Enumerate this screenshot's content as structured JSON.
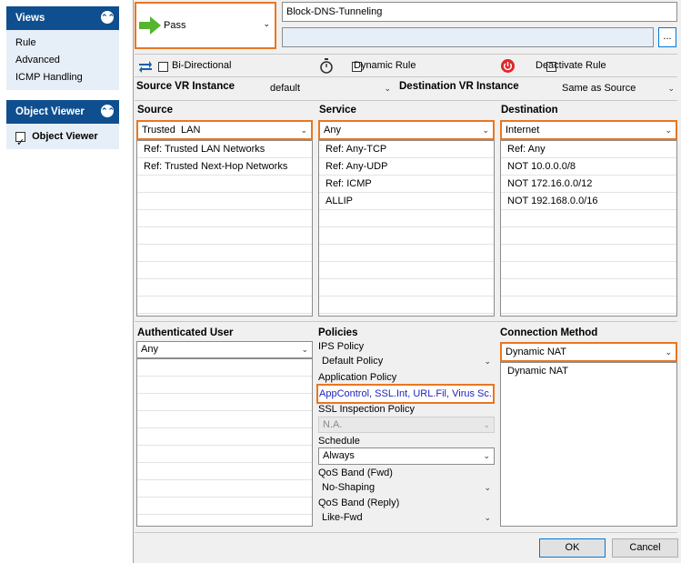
{
  "views": {
    "title": "Views",
    "items": [
      "Rule",
      "Advanced",
      "ICMP Handling"
    ]
  },
  "object_viewer": {
    "title": "Object Viewer",
    "checkbox_label": "Object Viewer",
    "checked": true
  },
  "action": {
    "label": "Pass",
    "color": "#55b52e"
  },
  "rule": {
    "name": "Block-DNS-Tunneling",
    "comment": "",
    "browse_label": "..."
  },
  "options": {
    "bidirectional": "Bi-Directional",
    "dynamic_rule": "Dynamic Rule",
    "deactivate_rule": "Deactivate Rule"
  },
  "vr": {
    "source_label": "Source VR Instance",
    "source_value": "default",
    "dest_label": "Destination VR Instance",
    "dest_value": "Same as Source"
  },
  "source": {
    "label": "Source",
    "selected": "Trusted  LAN",
    "items": [
      "Ref: Trusted LAN Networks",
      "Ref: Trusted Next-Hop Networks"
    ]
  },
  "service": {
    "label": "Service",
    "selected": "Any",
    "items": [
      "Ref: Any-TCP",
      "Ref: Any-UDP",
      "Ref: ICMP",
      "ALLIP"
    ]
  },
  "destination": {
    "label": "Destination",
    "selected": "Internet",
    "items": [
      "Ref: Any",
      "NOT 10.0.0.0/8",
      "NOT 172.16.0.0/12",
      "NOT 192.168.0.0/16"
    ]
  },
  "auth_user": {
    "label": "Authenticated User",
    "selected": "Any"
  },
  "policies": {
    "label": "Policies",
    "ips_label": "IPS Policy",
    "ips_value": "Default Policy",
    "app_label": "Application Policy",
    "app_value": "AppControl, SSL.Int, URL.Fil, Virus Sc...",
    "ssl_label": "SSL Inspection Policy",
    "ssl_value": "N.A.",
    "schedule_label": "Schedule",
    "schedule_value": "Always",
    "qos_fwd_label": "QoS Band (Fwd)",
    "qos_fwd_value": "No-Shaping",
    "qos_reply_label": "QoS Band (Reply)",
    "qos_reply_value": "Like-Fwd"
  },
  "connection": {
    "label": "Connection Method",
    "selected": "Dynamic NAT",
    "items": [
      "Dynamic NAT"
    ]
  },
  "buttons": {
    "ok": "OK",
    "cancel": "Cancel"
  },
  "colors": {
    "accent_orange": "#e87722",
    "header_blue": "#0f4f8f",
    "deactivate_red": "#e0262b"
  }
}
